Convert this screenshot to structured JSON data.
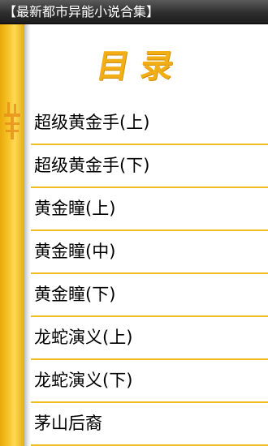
{
  "app": {
    "title": "【最新都市异能小说合集】"
  },
  "header": {
    "title": "目录"
  },
  "toc": {
    "items": [
      {
        "label": "超级黄金手(上)"
      },
      {
        "label": "超级黄金手(下)"
      },
      {
        "label": "黄金瞳(上)"
      },
      {
        "label": "黄金瞳(中)"
      },
      {
        "label": "黄金瞳(下)"
      },
      {
        "label": "龙蛇演义(上)"
      },
      {
        "label": "龙蛇演义(下)"
      },
      {
        "label": "茅山后裔"
      }
    ]
  },
  "colors": {
    "accent": "#f2ae14",
    "spine": "#f6c42a",
    "divider": "#f1bd23",
    "title_bar": "#2e2e2e"
  },
  "icons": {
    "spine_ornament": "seal-ornament-icon"
  }
}
